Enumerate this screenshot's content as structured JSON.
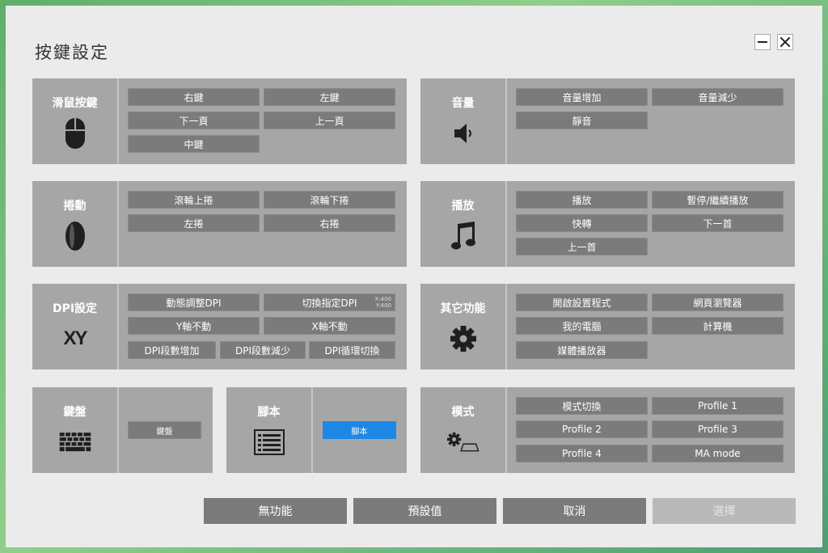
{
  "window": {
    "title": "按鍵設定"
  },
  "groups": {
    "mouse": {
      "title": "滑鼠按鍵",
      "icon": "mouse-icon",
      "options": [
        "右鍵",
        "左鍵",
        "下一頁",
        "上一頁",
        "中鍵"
      ]
    },
    "volume": {
      "title": "音量",
      "icon": "speaker-icon",
      "options": [
        "音量增加",
        "音量減少",
        "靜音"
      ]
    },
    "scroll": {
      "title": "捲動",
      "icon": "scroll-wheel-icon",
      "options": [
        "滾輪上捲",
        "滾輪下捲",
        "左捲",
        "右捲"
      ]
    },
    "play": {
      "title": "播放",
      "icon": "music-note-icon",
      "options": [
        "播放",
        "暫停/繼續播放",
        "快轉",
        "下一首",
        "上一首"
      ]
    },
    "dpi": {
      "title": "DPI設定",
      "icon": "xy-icon",
      "icon_text": "XY",
      "options": [
        "動態調整DPI",
        "切換指定DPI",
        "Y軸不動",
        "X軸不動",
        "DPI段數增加",
        "DPI段數減少",
        "DPI循環切換"
      ],
      "dpi_values": [
        "X:400",
        "Y:400"
      ]
    },
    "other": {
      "title": "其它功能",
      "icon": "gear-icon",
      "options": [
        "開啟設置程式",
        "網頁瀏覽器",
        "我的電腦",
        "計算機",
        "媒體播放器"
      ]
    },
    "keyboard": {
      "title": "鍵盤",
      "icon": "keyboard-icon",
      "options": [
        "鍵盤"
      ]
    },
    "script": {
      "title": "腳本",
      "icon": "script-list-icon",
      "options": [
        "腳本"
      ]
    },
    "mode": {
      "title": "模式",
      "icon": "gear-mode-icon",
      "options": [
        "模式切換",
        "Profile 1",
        "Profile 2",
        "Profile 3",
        "Profile 4",
        "MA mode"
      ]
    }
  },
  "footer": {
    "no_function": "無功能",
    "default": "預設值",
    "cancel": "取消",
    "select": "選擇"
  },
  "colors": {
    "selected": "#1e87e5",
    "option_bg": "#7b7b7b",
    "group_bg": "#a6a6a6"
  }
}
